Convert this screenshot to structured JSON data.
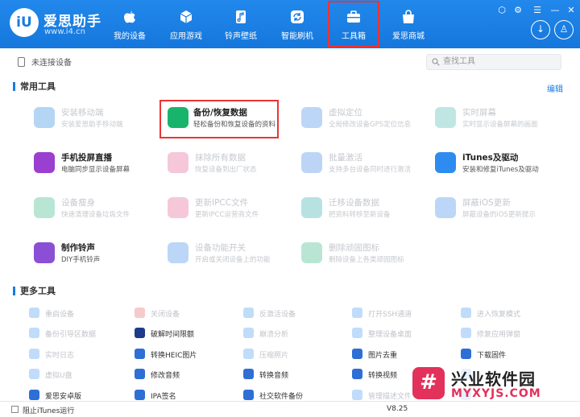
{
  "app": {
    "name": "爱思助手",
    "url": "www.i4.cn"
  },
  "nav": [
    {
      "label": "我的设备",
      "icon": "apple-icon"
    },
    {
      "label": "应用游戏",
      "icon": "cube-icon"
    },
    {
      "label": "铃声壁纸",
      "icon": "music-file-icon"
    },
    {
      "label": "智能刷机",
      "icon": "refresh-icon"
    },
    {
      "label": "工具箱",
      "icon": "toolbox-icon",
      "active": true
    },
    {
      "label": "爱思商城",
      "icon": "shopping-bag-icon"
    }
  ],
  "device": {
    "status": "未连接设备"
  },
  "search": {
    "placeholder": "查找工具"
  },
  "sections": {
    "common": "常用工具",
    "more": "更多工具",
    "edit": "编辑"
  },
  "tools": [
    {
      "title": "安装移动端",
      "desc": "安装爱思助手移动端",
      "color": "#1a7be0",
      "dim": true
    },
    {
      "title": "备份/恢复数据",
      "desc": "轻松备份和恢复设备的资料",
      "color": "#19b46c",
      "dim": false,
      "highlight": true
    },
    {
      "title": "虚拟定位",
      "desc": "全局修改设备GPS定位信息",
      "color": "#2e7ee6",
      "dim": true
    },
    {
      "title": "实时屏幕",
      "desc": "实时显示设备屏幕的画面",
      "color": "#3bb0a8",
      "dim": true
    },
    {
      "title": "手机投屏直播",
      "desc": "电脑同步显示设备屏幕",
      "color": "#9a3fd0",
      "dim": false
    },
    {
      "title": "抹除所有数据",
      "desc": "恢复设备到出厂状态",
      "color": "#e0508a",
      "dim": true
    },
    {
      "title": "批量激活",
      "desc": "支持多台设备同时进行激活",
      "color": "#2f7de6",
      "dim": true
    },
    {
      "title": "iTunes及驱动",
      "desc": "安装和修复iTunes及驱动",
      "color": "#2e8cf0",
      "dim": false
    },
    {
      "title": "设备瘦身",
      "desc": "快速清理设备垃圾文件",
      "color": "#25b07a",
      "dim": true
    },
    {
      "title": "更新IPCC文件",
      "desc": "更新IPCC运营商文件",
      "color": "#e0508a",
      "dim": true
    },
    {
      "title": "迁移设备数据",
      "desc": "把资料转移至新设备",
      "color": "#23a6a3",
      "dim": true
    },
    {
      "title": "屏蔽iOS更新",
      "desc": "屏蔽设备的iOS更新提示",
      "color": "#2e7ee6",
      "dim": true
    },
    {
      "title": "制作铃声",
      "desc": "DIY手机铃声",
      "color": "#8b4fd6",
      "dim": false
    },
    {
      "title": "设备功能开关",
      "desc": "开启或关闭设备上的功能",
      "color": "#2e7ee6",
      "dim": true
    },
    {
      "title": "删除顽固图标",
      "desc": "删除设备上各类顽固图标",
      "color": "#25b07a",
      "dim": true
    }
  ],
  "more_tools": [
    {
      "label": "重启设备",
      "color": "#2e8cf0",
      "dim": true
    },
    {
      "label": "关闭设备",
      "color": "#e05050",
      "dim": true
    },
    {
      "label": "反激活设备",
      "color": "#2e8cf0",
      "dim": true
    },
    {
      "label": "打开SSH通道",
      "color": "#2e8cf0",
      "dim": true
    },
    {
      "label": "进入恢复模式",
      "color": "#2e8cf0",
      "dim": true
    },
    {
      "label": "备份引导区数据",
      "color": "#2e8cf0",
      "dim": true
    },
    {
      "label": "破解时间限额",
      "color": "#1e3a8a",
      "dim": false
    },
    {
      "label": "崩溃分析",
      "color": "#2e8cf0",
      "dim": true
    },
    {
      "label": "整理设备桌面",
      "color": "#2e8cf0",
      "dim": true
    },
    {
      "label": "修复应用弹窗",
      "color": "#2e8cf0",
      "dim": true
    },
    {
      "label": "实时日志",
      "color": "#2e8cf0",
      "dim": true
    },
    {
      "label": "转换HEIC图片",
      "color": "#2e6fd6",
      "dim": false
    },
    {
      "label": "压缩照片",
      "color": "#2e8cf0",
      "dim": true
    },
    {
      "label": "图片去重",
      "color": "#2e6fd6",
      "dim": false
    },
    {
      "label": "下载固件",
      "color": "#2e6fd6",
      "dim": false
    },
    {
      "label": "虚拟U盘",
      "color": "#2e8cf0",
      "dim": true
    },
    {
      "label": "修改音频",
      "color": "#2e6fd6",
      "dim": false
    },
    {
      "label": "转换音频",
      "color": "#2e6fd6",
      "dim": false
    },
    {
      "label": "转换视频",
      "color": "#2e6fd6",
      "dim": false
    },
    {
      "label": "",
      "color": "#2e8cf0",
      "dim": true
    },
    {
      "label": "爱思安卓版",
      "color": "#2e6fd6",
      "dim": false
    },
    {
      "label": "IPA签名",
      "color": "#2e6fd6",
      "dim": false,
      "icon_text": "IPA"
    },
    {
      "label": "社交软件备份",
      "color": "#2e6fd6",
      "dim": false
    },
    {
      "label": "管理描述文件",
      "color": "#2e8cf0",
      "dim": true
    },
    {
      "label": "",
      "color": "#2e8cf0",
      "dim": true
    }
  ],
  "footer": {
    "itunes_label": "阻止iTunes运行",
    "version": "V8.25"
  },
  "watermark": {
    "line1": "兴业软件园",
    "line2": "MYXYJS.COM",
    "glyph": "#"
  }
}
